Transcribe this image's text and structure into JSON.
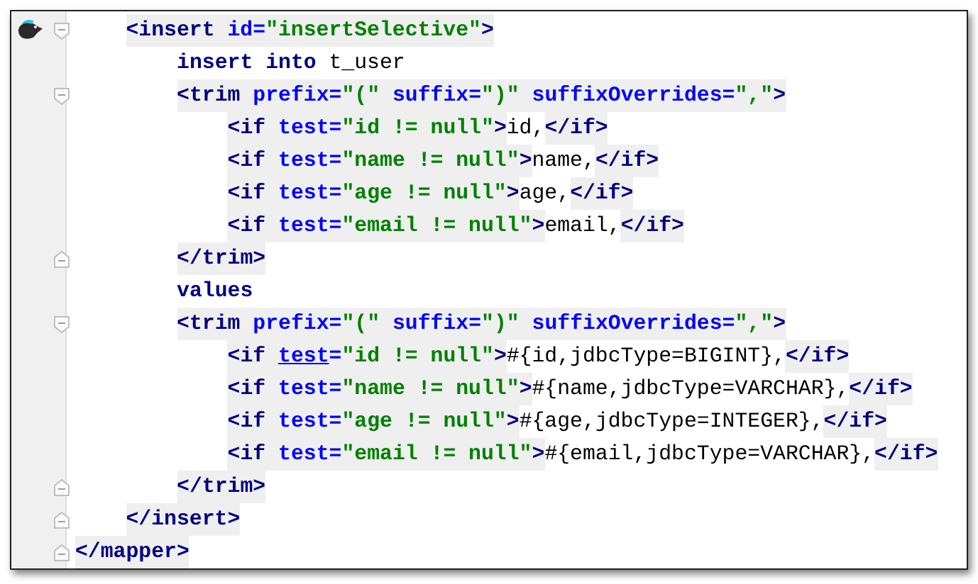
{
  "editor": {
    "lines": [
      {
        "children": [
          {
            "fold": {
              "kind": "start"
            },
            "tokens": [
              {
                "kind": "tag",
                "text": "<insert "
              },
              {
                "kind": "attr",
                "text": "id="
              },
              {
                "kind": "value",
                "text": "\"insertSelective\""
              },
              {
                "kind": "tag",
                "text": ">"
              }
            ],
            "children": [
              {
                "tokens": [
                  {
                    "kind": "keyword",
                    "text": "insert into"
                  },
                  {
                    "kind": "text",
                    "text": " t_user"
                  }
                ]
              },
              {
                "fold": {
                  "kind": "start"
                },
                "tokens": [
                  {
                    "kind": "tag",
                    "text": "<trim "
                  },
                  {
                    "kind": "attr",
                    "text": "prefix="
                  },
                  {
                    "kind": "value",
                    "text": "\"(\""
                  },
                  {
                    "kind": "attr",
                    "text": " suffix="
                  },
                  {
                    "kind": "value",
                    "text": "\")\""
                  },
                  {
                    "kind": "attr",
                    "text": " suffixOverrides="
                  },
                  {
                    "kind": "value",
                    "text": "\",\""
                  },
                  {
                    "kind": "tag",
                    "text": ">"
                  }
                ],
                "children": [
                  {
                    "tokens": [
                      {
                        "kind": "tag",
                        "text": "<if "
                      },
                      {
                        "kind": "attr",
                        "text": "test="
                      },
                      {
                        "kind": "value",
                        "text": "\"id != null\""
                      },
                      {
                        "kind": "tag",
                        "text": ">"
                      },
                      {
                        "kind": "text",
                        "text": "id,"
                      },
                      {
                        "kind": "tag",
                        "text": "</if>"
                      }
                    ]
                  },
                  {
                    "tokens": [
                      {
                        "kind": "tag",
                        "text": "<if "
                      },
                      {
                        "kind": "attr",
                        "text": "test="
                      },
                      {
                        "kind": "value",
                        "text": "\"name != null\""
                      },
                      {
                        "kind": "tag",
                        "text": ">"
                      },
                      {
                        "kind": "text",
                        "text": "name,"
                      },
                      {
                        "kind": "tag",
                        "text": "</if>"
                      }
                    ]
                  },
                  {
                    "tokens": [
                      {
                        "kind": "tag",
                        "text": "<if "
                      },
                      {
                        "kind": "attr",
                        "text": "test="
                      },
                      {
                        "kind": "value",
                        "text": "\"age != null\""
                      },
                      {
                        "kind": "tag",
                        "text": ">"
                      },
                      {
                        "kind": "text",
                        "text": "age,"
                      },
                      {
                        "kind": "tag",
                        "text": "</if>"
                      }
                    ]
                  },
                  {
                    "tokens": [
                      {
                        "kind": "tag",
                        "text": "<if "
                      },
                      {
                        "kind": "attr",
                        "text": "test="
                      },
                      {
                        "kind": "value",
                        "text": "\"email != null\""
                      },
                      {
                        "kind": "tag",
                        "text": ">"
                      },
                      {
                        "kind": "text",
                        "text": "email,"
                      },
                      {
                        "kind": "tag",
                        "text": "</if>"
                      }
                    ]
                  }
                ]
              },
              {
                "fold": {
                  "kind": "end"
                },
                "tokens": [
                  {
                    "kind": "tag",
                    "text": "</trim>"
                  }
                ]
              },
              {
                "tokens": [
                  {
                    "kind": "keyword",
                    "text": "values"
                  }
                ]
              },
              {
                "fold": {
                  "kind": "start"
                },
                "tokens": [
                  {
                    "kind": "tag",
                    "text": "<trim "
                  },
                  {
                    "kind": "attr",
                    "text": "prefix="
                  },
                  {
                    "kind": "value",
                    "text": "\"(\""
                  },
                  {
                    "kind": "attr",
                    "text": " suffix="
                  },
                  {
                    "kind": "value",
                    "text": "\")\""
                  },
                  {
                    "kind": "attr",
                    "text": " suffixOverrides="
                  },
                  {
                    "kind": "value",
                    "text": "\",\""
                  },
                  {
                    "kind": "tag",
                    "text": ">"
                  }
                ],
                "children": [
                  {
                    "tokens": [
                      {
                        "kind": "tag",
                        "text": "<if "
                      },
                      {
                        "kind": "link",
                        "text": "test"
                      },
                      {
                        "kind": "attr",
                        "text": "="
                      },
                      {
                        "kind": "value",
                        "text": "\"id != null\""
                      },
                      {
                        "kind": "tag",
                        "text": ">"
                      },
                      {
                        "kind": "text",
                        "text": "#{id,jdbcType=BIGINT},"
                      },
                      {
                        "kind": "tag",
                        "text": "</if>"
                      }
                    ]
                  },
                  {
                    "tokens": [
                      {
                        "kind": "tag",
                        "text": "<if "
                      },
                      {
                        "kind": "attr",
                        "text": "test="
                      },
                      {
                        "kind": "value",
                        "text": "\"name != null\""
                      },
                      {
                        "kind": "tag",
                        "text": ">"
                      },
                      {
                        "kind": "text",
                        "text": "#{name,jdbcType=VARCHAR},"
                      },
                      {
                        "kind": "tag",
                        "text": "</if>"
                      }
                    ]
                  },
                  {
                    "tokens": [
                      {
                        "kind": "tag",
                        "text": "<if "
                      },
                      {
                        "kind": "attr",
                        "text": "test="
                      },
                      {
                        "kind": "value",
                        "text": "\"age != null\""
                      },
                      {
                        "kind": "tag",
                        "text": ">"
                      },
                      {
                        "kind": "text",
                        "text": "#{age,jdbcType=INTEGER},"
                      },
                      {
                        "kind": "tag",
                        "text": "</if>"
                      }
                    ]
                  },
                  {
                    "tokens": [
                      {
                        "kind": "tag",
                        "text": "<if "
                      },
                      {
                        "kind": "attr",
                        "text": "test="
                      },
                      {
                        "kind": "value",
                        "text": "\"email != null\""
                      },
                      {
                        "kind": "tag",
                        "text": ">"
                      },
                      {
                        "kind": "text",
                        "text": "#{email,jdbcType=VARCHAR},"
                      },
                      {
                        "kind": "tag",
                        "text": "</if>"
                      }
                    ]
                  }
                ]
              },
              {
                "fold": {
                  "kind": "end"
                },
                "tokens": [
                  {
                    "kind": "tag",
                    "text": "</trim>"
                  }
                ]
              }
            ]
          },
          {
            "fold": {
              "kind": "end"
            },
            "tokens": [
              {
                "kind": "tag",
                "text": "</insert>"
              }
            ]
          }
        ]
      },
      {
        "fold": {
          "kind": "end"
        },
        "tokens": [
          {
            "kind": "tag",
            "text": "</mapper>"
          }
        ]
      }
    ]
  }
}
